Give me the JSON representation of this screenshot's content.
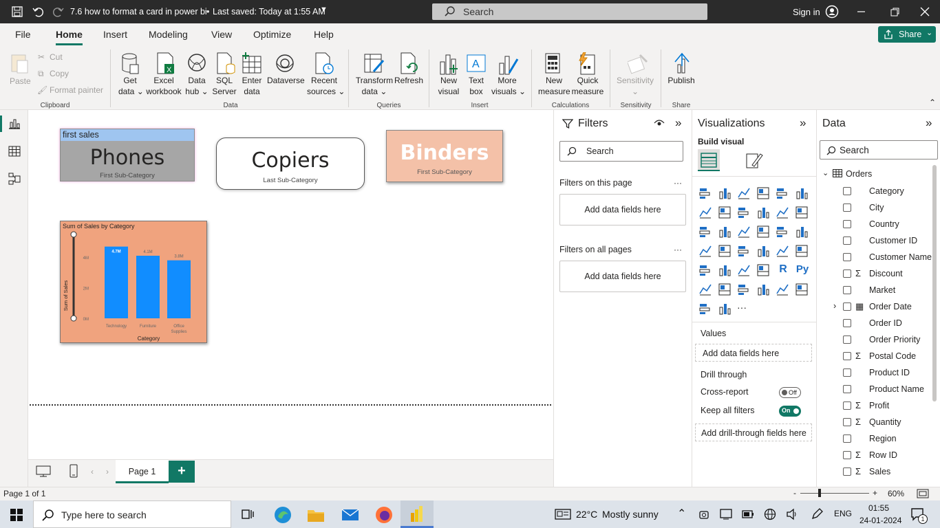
{
  "titlebar": {
    "file_title": "7.6 how to format a card in power bi",
    "saved_status": "Last saved: Today at 1:55 AM",
    "search_placeholder": "Search",
    "sign_in": "Sign in"
  },
  "menu": {
    "items": [
      "File",
      "Home",
      "Insert",
      "Modeling",
      "View",
      "Optimize",
      "Help"
    ],
    "active": "Home",
    "share": "Share"
  },
  "ribbon": {
    "clipboard": {
      "paste": "Paste",
      "cut": "Cut",
      "copy": "Copy",
      "format_painter": "Format painter",
      "group": "Clipboard"
    },
    "data": {
      "get_data_1": "Get",
      "get_data_2": "data",
      "excel_1": "Excel",
      "excel_2": "workbook",
      "datahub_1": "Data",
      "datahub_2": "hub",
      "sql_1": "SQL",
      "sql_2": "Server",
      "enter_1": "Enter",
      "enter_2": "data",
      "dataverse": "Dataverse",
      "recent_1": "Recent",
      "recent_2": "sources",
      "group": "Data"
    },
    "queries": {
      "transform_1": "Transform",
      "transform_2": "data",
      "refresh": "Refresh",
      "group": "Queries"
    },
    "insert": {
      "newvisual_1": "New",
      "newvisual_2": "visual",
      "textbox_1": "Text",
      "textbox_2": "box",
      "morevisuals_1": "More",
      "morevisuals_2": "visuals",
      "group": "Insert"
    },
    "calculations": {
      "newmeasure_1": "New",
      "newmeasure_2": "measure",
      "quick_1": "Quick",
      "quick_2": "measure",
      "group": "Calculations"
    },
    "sensitivity": {
      "label": "Sensitivity",
      "group": "Sensitivity"
    },
    "share": {
      "publish": "Publish",
      "group": "Share"
    }
  },
  "cards": {
    "card1": {
      "header": "first sales",
      "value": "Phones",
      "label": "First Sub-Category"
    },
    "card2": {
      "value": "Copiers",
      "label": "Last Sub-Category"
    },
    "card3": {
      "value": "Binders",
      "label": "First Sub-Category"
    }
  },
  "chart_data": {
    "type": "bar",
    "title": "Sum of Sales by Category",
    "xlabel": "Category",
    "ylabel": "Sum of Sales",
    "categories": [
      "Technology",
      "Furniture",
      "Office Supplies"
    ],
    "values": [
      4.7,
      4.1,
      3.8
    ],
    "data_labels": [
      "4.7M",
      "4.1M",
      "3.8M"
    ],
    "yticks": [
      "0M",
      "2M",
      "4M"
    ],
    "ylim": [
      0,
      5
    ],
    "bar_color": "#118dff",
    "background_color": "#f0a37e"
  },
  "pages": {
    "tab": "Page 1",
    "add": "+"
  },
  "status": {
    "page_count": "Page 1 of 1",
    "zoom": "60%",
    "zoom_minus": "-",
    "zoom_plus": "+"
  },
  "filters": {
    "title": "Filters",
    "search": "Search",
    "this_page": "Filters on this page",
    "all_pages": "Filters on all pages",
    "dropzone": "Add data fields here",
    "more": "···"
  },
  "visualizations": {
    "title": "Visualizations",
    "build_visual": "Build visual",
    "values": "Values",
    "values_drop": "Add data fields here",
    "drill_through": "Drill through",
    "cross_report": "Cross-report",
    "cross_report_state": "Off",
    "keep_filters": "Keep all filters",
    "keep_filters_state": "On",
    "drill_drop": "Add drill-through fields here",
    "more": "···",
    "icons_row": [
      "R",
      "Py"
    ]
  },
  "data": {
    "title": "Data",
    "search": "Search",
    "table": "Orders",
    "fields": [
      {
        "name": "Category",
        "sigma": ""
      },
      {
        "name": "City",
        "sigma": ""
      },
      {
        "name": "Country",
        "sigma": ""
      },
      {
        "name": "Customer ID",
        "sigma": ""
      },
      {
        "name": "Customer Name",
        "sigma": ""
      },
      {
        "name": "Discount",
        "sigma": "Σ"
      },
      {
        "name": "Market",
        "sigma": ""
      },
      {
        "name": "Order Date",
        "sigma": "▦"
      },
      {
        "name": "Order ID",
        "sigma": ""
      },
      {
        "name": "Order Priority",
        "sigma": ""
      },
      {
        "name": "Postal Code",
        "sigma": "Σ"
      },
      {
        "name": "Product ID",
        "sigma": ""
      },
      {
        "name": "Product Name",
        "sigma": ""
      },
      {
        "name": "Profit",
        "sigma": "Σ"
      },
      {
        "name": "Quantity",
        "sigma": "Σ"
      },
      {
        "name": "Region",
        "sigma": ""
      },
      {
        "name": "Row ID",
        "sigma": "Σ"
      },
      {
        "name": "Sales",
        "sigma": "Σ"
      }
    ]
  },
  "taskbar": {
    "search": "Type here to search",
    "weather_temp": "22°C",
    "weather_text": "Mostly sunny",
    "lang": "ENG",
    "time": "01:55",
    "date": "24-01-2024",
    "notif": "1"
  }
}
